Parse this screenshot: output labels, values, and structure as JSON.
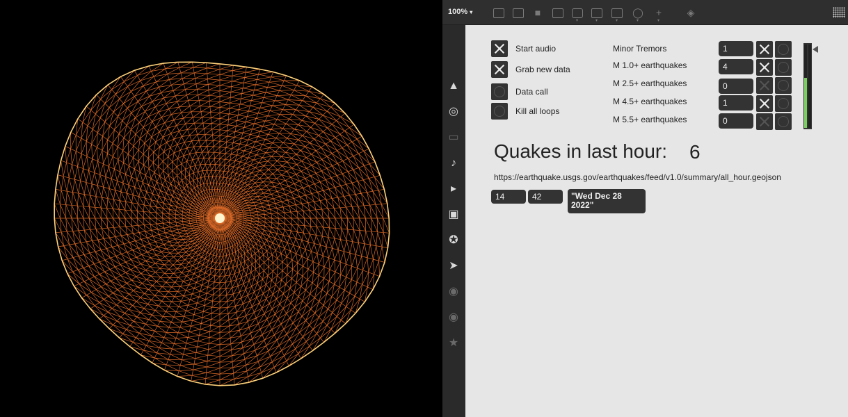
{
  "toolbar": {
    "zoom": "100%",
    "zoom_caret": "▾"
  },
  "controls": {
    "start_audio": "Start audio",
    "grab_new_data": "Grab new data",
    "data_call": "Data call",
    "kill_all_loops": "Kill all loops"
  },
  "categories": [
    {
      "label": "Minor Tremors",
      "value": "1"
    },
    {
      "label": "M 1.0+ earthquakes",
      "value": "4"
    },
    {
      "label": "M 2.5+ earthquakes",
      "value": "0"
    },
    {
      "label": "M 4.5+ earthquakes",
      "value": "1"
    },
    {
      "label": "M 5.5+ earthquakes",
      "value": "0"
    }
  ],
  "meter": {
    "level": 0.6,
    "color": "#7dce62"
  },
  "headline": {
    "title": "Quakes in last hour:",
    "count": "6"
  },
  "feed_url": "https://earthquake.usgs.gov/earthquakes/feed/v1.0/summary/all_hour.geojson",
  "time": {
    "hour": "14",
    "minute": "42",
    "date": "\"Wed Dec 28 2022\""
  },
  "colors": {
    "viz_stroke": "#ff7a2e",
    "viz_highlight": "#ffd27a",
    "canvas_bg": "#e6e6e6"
  }
}
